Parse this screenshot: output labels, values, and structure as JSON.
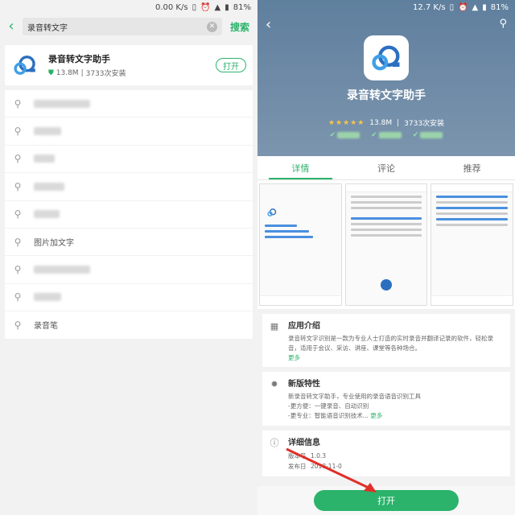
{
  "left": {
    "status": {
      "speed": "0.00 K/s",
      "battery": "81%"
    },
    "search": {
      "value": "录音转文字",
      "button": "搜索"
    },
    "result": {
      "name": "录音转文字助手",
      "size": "13.8M",
      "separator": "|",
      "installs": "3733次安装",
      "open_label": "打开"
    },
    "suggestions": [
      {
        "text": "",
        "blur_width": 70
      },
      {
        "text": "",
        "blur_width": 34
      },
      {
        "text": "",
        "blur_width": 26
      },
      {
        "text": "",
        "blur_width": 38
      },
      {
        "text": "",
        "blur_width": 32
      },
      {
        "text": "图片加文字",
        "blur_width": 0
      },
      {
        "text": "",
        "blur_width": 70
      },
      {
        "text": "",
        "blur_width": 34
      },
      {
        "text": "录音笔",
        "blur_width": 0
      }
    ]
  },
  "right": {
    "status": {
      "speed": "12.7 K/s",
      "battery": "81%"
    },
    "app_name": "录音转文字助手",
    "stars": "★★★★★",
    "size": "13.8M",
    "installs": "3733次安装",
    "tabs": [
      {
        "label": "详情",
        "active": true
      },
      {
        "label": "评论",
        "active": false
      },
      {
        "label": "推荐",
        "active": false
      }
    ],
    "intro": {
      "title": "应用介绍",
      "text": "录音转文字识别是一款为专业人士打造的实时录音并翻译记录的软件，轻松录音，适用于会议、采访、讲座、课堂等各种场合。",
      "more": "更多"
    },
    "new_features": {
      "title": "新版特性",
      "line1": "新录音转文字助手，专业使用的录音语音识别工具",
      "line2": "-更方便：一键录音、自动识别",
      "line3": "-更专业：智能语音识别技术...",
      "more": "更多"
    },
    "details": {
      "title": "详细信息",
      "rows": [
        {
          "k": "版本号",
          "v": "1.0.3"
        },
        {
          "k": "发布日",
          "v": "2018-11-0"
        }
      ]
    },
    "open_label": "打开",
    "colors": {
      "accent": "#2bb36b",
      "hero": "#6b89a6"
    }
  }
}
